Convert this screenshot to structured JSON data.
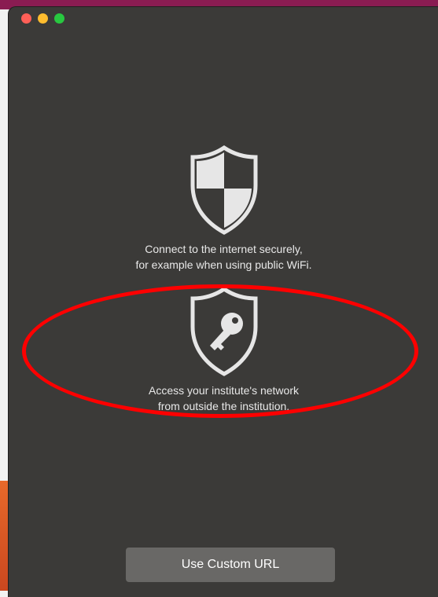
{
  "window": {
    "controls": [
      "close",
      "minimize",
      "zoom"
    ]
  },
  "options": [
    {
      "icon": "shield-checker-icon",
      "line1": "Connect to the internet securely,",
      "line2": "for example when using public WiFi."
    },
    {
      "icon": "shield-key-icon",
      "line1": "Access your institute's network",
      "line2": "from outside the institution."
    }
  ],
  "custom_url_button": {
    "label": "Use Custom URL"
  },
  "annotation": {
    "color": "#ff0000"
  }
}
